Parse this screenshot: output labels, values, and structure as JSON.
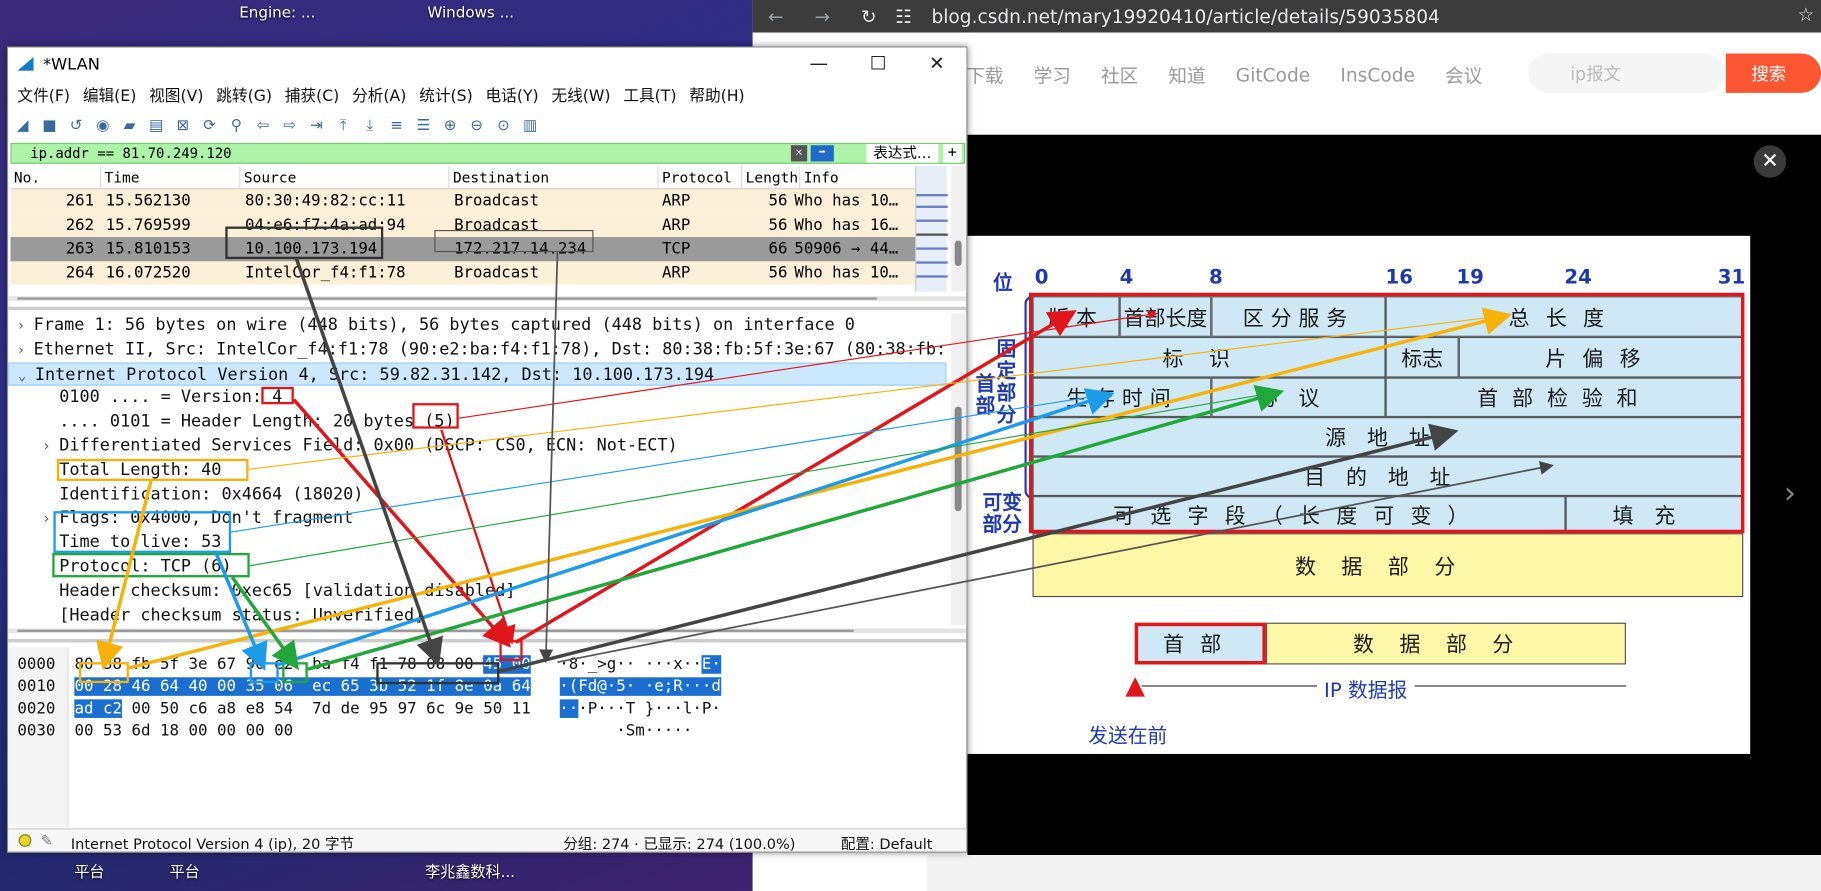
{
  "desktop": {
    "labels_top": [
      "Engine: ...",
      "Windows ..."
    ],
    "labels_bottom": [
      "平台",
      "平台",
      "李兆鑫数科..."
    ]
  },
  "browser": {
    "url": "blog.csdn.net/mary19920410/article/details/59035804",
    "nav_items": [
      "下载",
      "学习",
      "社区",
      "知道",
      "GitCode",
      "InsCode",
      "会议"
    ],
    "search_placeholder": "ip报文",
    "search_button": "搜索"
  },
  "diagram": {
    "bit_labels": [
      "位",
      "0",
      "4",
      "8",
      "16",
      "19",
      "24",
      "31"
    ],
    "fixed_part": "固定部分",
    "variable_part": "可变部分",
    "header_side": "首部",
    "fields": {
      "version": "版本",
      "header_length": "首部长度",
      "ds": "区分服务",
      "total_length": "总长度",
      "identification": "标识",
      "flags": "标志",
      "fragment_offset": "片偏移",
      "ttl": "生存时间",
      "protocol": "协议",
      "checksum": "首部检验和",
      "src": "源地址",
      "dst": "目的地址",
      "options": "可选字段（长度可变）",
      "padding": "填充",
      "data": "数据部分"
    },
    "packet": {
      "header": "首部",
      "data": "数据部分",
      "label": "IP 数据报",
      "send_first": "发送在前"
    }
  },
  "wireshark": {
    "title": "*WLAN",
    "menu": [
      "文件(F)",
      "编辑(E)",
      "视图(V)",
      "跳转(G)",
      "捕获(C)",
      "分析(A)",
      "统计(S)",
      "电话(Y)",
      "无线(W)",
      "工具(T)",
      "帮助(H)"
    ],
    "filter": "ip.addr == 81.70.249.120",
    "filter_expression": "表达式…",
    "columns": [
      "No.",
      "Time",
      "Source",
      "Destination",
      "Protocol",
      "Length",
      "Info"
    ],
    "packets": [
      {
        "no": "261",
        "time": "15.562130",
        "src": "80:30:49:82:cc:11",
        "dst": "Broadcast",
        "proto": "ARP",
        "len": "56",
        "info": "Who has 10…"
      },
      {
        "no": "262",
        "time": "15.769599",
        "src": "04:e6:f7:4a:ad:94",
        "dst": "Broadcast",
        "proto": "ARP",
        "len": "56",
        "info": "Who has 16…"
      },
      {
        "no": "263",
        "time": "15.810153",
        "src": "10.100.173.194",
        "dst": "172.217.14.234",
        "proto": "TCP",
        "len": "66",
        "info": "50906 → 44…"
      },
      {
        "no": "264",
        "time": "16.072520",
        "src": "IntelCor_f4:f1:78",
        "dst": "Broadcast",
        "proto": "ARP",
        "len": "56",
        "info": "Who has 10…"
      }
    ],
    "details": [
      {
        "arrow": "›",
        "text": "Frame 1: 56 bytes on wire (448 bits), 56 bytes captured (448 bits) on interface 0"
      },
      {
        "arrow": "›",
        "text": "Ethernet II, Src: IntelCor_f4:f1:78 (90:e2:ba:f4:f1:78), Dst: 80:38:fb:5f:3e:67 (80:38:fb:5"
      },
      {
        "arrow": "⌄",
        "text": "Internet Protocol Version 4, Src: 59.82.31.142, Dst: 10.100.173.194"
      },
      {
        "arrow": "",
        "text": "0100 .... = Version: 4"
      },
      {
        "arrow": "",
        "text": ".... 0101 = Header Length: 20 bytes (5)"
      },
      {
        "arrow": "›",
        "text": "Differentiated Services Field: 0x00 (DSCP: CS0, ECN: Not-ECT)"
      },
      {
        "arrow": "",
        "text": "Total Length: 40"
      },
      {
        "arrow": "",
        "text": "Identification: 0x4664 (18020)"
      },
      {
        "arrow": "›",
        "text": "Flags: 0x4000, Don't fragment"
      },
      {
        "arrow": "",
        "text": "Time to live: 53"
      },
      {
        "arrow": "",
        "text": "Protocol: TCP (6)"
      },
      {
        "arrow": "",
        "text": "Header checksum: 0xec65 [validation disabled]"
      },
      {
        "arrow": "",
        "text": "[Header checksum status: Unverified]"
      }
    ],
    "bytes": [
      {
        "off": "0000",
        "hex_a": "80 38 fb 5f 3e 67 90 e2  ba f4 f1 78 08 00 ",
        "hex_b": "45 00",
        "asc_a": "·8·_>g·· ···x··",
        "asc_b": "E·"
      },
      {
        "off": "0010",
        "hex_sel": "00 28 46 64 40 00 35 06  ec 65 3b 52 1f 8e 0a 64",
        "asc_sel": "·(Fd@·5· ·e;R···d"
      },
      {
        "off": "0020",
        "hex_sel": "ad c2",
        "hex_c": " 00 50 c6 a8 e8 54  7d de 95 97 6c 9e 50 11",
        "asc_sel": "··",
        "asc_c": "·P···T }···l·P·"
      },
      {
        "off": "0030",
        "hex_c": "00 53 6d 18 00 00 00 00",
        "asc_c": "·Sm·····"
      }
    ],
    "status_left": "Internet Protocol Version 4 (ip), 20 字节",
    "status_packets": "分组: 274 · 已显示: 274 (100.0%)",
    "status_profile": "配置: Default",
    "colors": {
      "filter_bg": "#adf3a8",
      "row_bg": "#faf0d7",
      "selected": "#1a6fd0"
    }
  }
}
